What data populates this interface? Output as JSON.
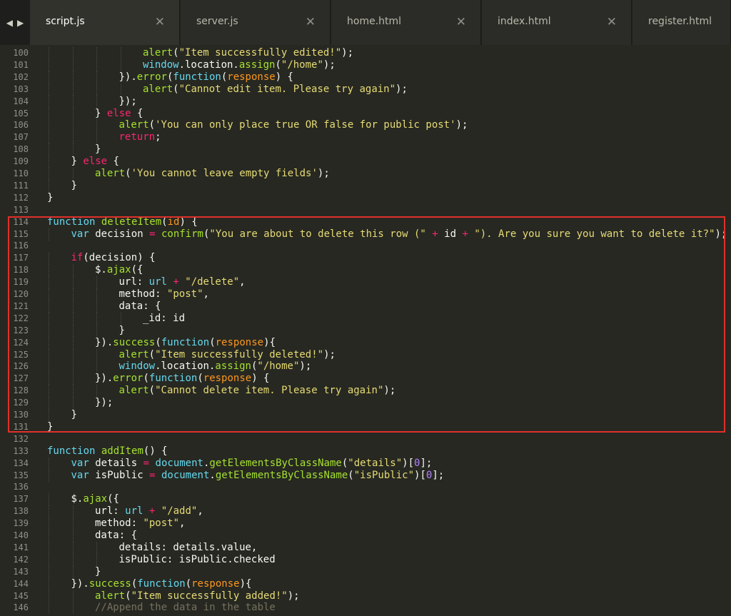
{
  "tabs": [
    {
      "label": "script.js",
      "active": true
    },
    {
      "label": "server.js",
      "active": false
    },
    {
      "label": "home.html",
      "active": false
    },
    {
      "label": "index.html",
      "active": false
    },
    {
      "label": "register.html",
      "active": false
    }
  ],
  "nav": {
    "back": "◀",
    "forward": "▶"
  },
  "tab_close_glyph": "✕",
  "highlight": {
    "color": "#e0302a",
    "from_line": 114,
    "to_line": 131
  },
  "lines": [
    {
      "n": "100",
      "indent": 4,
      "tokens": [
        [
          "fn",
          "alert"
        ],
        [
          "pl",
          "("
        ],
        [
          "str",
          "\"Item successfully edited!\""
        ],
        [
          "pl",
          ");"
        ]
      ]
    },
    {
      "n": "101",
      "indent": 4,
      "tokens": [
        [
          "bi",
          "window"
        ],
        [
          "pl",
          ".location."
        ],
        [
          "fn",
          "assign"
        ],
        [
          "pl",
          "("
        ],
        [
          "str",
          "\"/home\""
        ],
        [
          "pl",
          ");"
        ]
      ]
    },
    {
      "n": "102",
      "indent": 3,
      "tokens": [
        [
          "pl",
          "})."
        ],
        [
          "fn",
          "error"
        ],
        [
          "pl",
          "("
        ],
        [
          "bi",
          "function"
        ],
        [
          "pl",
          "("
        ],
        [
          "prm",
          "response"
        ],
        [
          "pl",
          ") {"
        ]
      ]
    },
    {
      "n": "103",
      "indent": 4,
      "tokens": [
        [
          "fn",
          "alert"
        ],
        [
          "pl",
          "("
        ],
        [
          "str",
          "\"Cannot edit item. Please try again\""
        ],
        [
          "pl",
          ");"
        ]
      ]
    },
    {
      "n": "104",
      "indent": 3,
      "tokens": [
        [
          "pl",
          "});"
        ]
      ]
    },
    {
      "n": "105",
      "indent": 2,
      "tokens": [
        [
          "pl",
          "} "
        ],
        [
          "kw",
          "else"
        ],
        [
          "pl",
          " {"
        ]
      ]
    },
    {
      "n": "106",
      "indent": 3,
      "tokens": [
        [
          "fn",
          "alert"
        ],
        [
          "pl",
          "("
        ],
        [
          "str",
          "'You can only place true OR false for public post'"
        ],
        [
          "pl",
          ");"
        ]
      ]
    },
    {
      "n": "107",
      "indent": 3,
      "tokens": [
        [
          "kw",
          "return"
        ],
        [
          "pl",
          ";"
        ]
      ]
    },
    {
      "n": "108",
      "indent": 2,
      "tokens": [
        [
          "pl",
          "}"
        ]
      ]
    },
    {
      "n": "109",
      "indent": 1,
      "tokens": [
        [
          "pl",
          "} "
        ],
        [
          "kw",
          "else"
        ],
        [
          "pl",
          " {"
        ]
      ]
    },
    {
      "n": "110",
      "indent": 2,
      "tokens": [
        [
          "fn",
          "alert"
        ],
        [
          "pl",
          "("
        ],
        [
          "str",
          "'You cannot leave empty fields'"
        ],
        [
          "pl",
          ");"
        ]
      ]
    },
    {
      "n": "111",
      "indent": 1,
      "tokens": [
        [
          "pl",
          "}"
        ]
      ]
    },
    {
      "n": "112",
      "indent": 0,
      "tokens": [
        [
          "pl",
          "}"
        ]
      ]
    },
    {
      "n": "113",
      "indent": 0,
      "tokens": []
    },
    {
      "n": "114",
      "indent": 0,
      "tokens": [
        [
          "bi",
          "function"
        ],
        [
          "pl",
          " "
        ],
        [
          "fn",
          "deleteItem"
        ],
        [
          "pl",
          "("
        ],
        [
          "prm",
          "id"
        ],
        [
          "pl",
          ") {"
        ]
      ]
    },
    {
      "n": "115",
      "indent": 1,
      "tokens": [
        [
          "bi",
          "var"
        ],
        [
          "pl",
          " decision "
        ],
        [
          "kw",
          "="
        ],
        [
          "pl",
          " "
        ],
        [
          "fn",
          "confirm"
        ],
        [
          "pl",
          "("
        ],
        [
          "str",
          "\"You are about to delete this row (\""
        ],
        [
          "pl",
          " "
        ],
        [
          "kw",
          "+"
        ],
        [
          "pl",
          " id "
        ],
        [
          "kw",
          "+"
        ],
        [
          "pl",
          " "
        ],
        [
          "str",
          "\"). Are you sure you want to delete it?\""
        ],
        [
          "pl",
          ");"
        ]
      ]
    },
    {
      "n": "116",
      "indent": 0,
      "tokens": []
    },
    {
      "n": "117",
      "indent": 1,
      "tokens": [
        [
          "kw",
          "if"
        ],
        [
          "pl",
          "(decision) {"
        ]
      ]
    },
    {
      "n": "118",
      "indent": 2,
      "tokens": [
        [
          "pl",
          "$."
        ],
        [
          "fn",
          "ajax"
        ],
        [
          "pl",
          "({"
        ]
      ]
    },
    {
      "n": "119",
      "indent": 3,
      "tokens": [
        [
          "pl",
          "url: "
        ],
        [
          "bi",
          "url"
        ],
        [
          "pl",
          " "
        ],
        [
          "kw",
          "+"
        ],
        [
          "pl",
          " "
        ],
        [
          "str",
          "\"/delete\""
        ],
        [
          "pl",
          ","
        ]
      ]
    },
    {
      "n": "120",
      "indent": 3,
      "tokens": [
        [
          "pl",
          "method: "
        ],
        [
          "str",
          "\"post\""
        ],
        [
          "pl",
          ","
        ]
      ]
    },
    {
      "n": "121",
      "indent": 3,
      "tokens": [
        [
          "pl",
          "data: {"
        ]
      ]
    },
    {
      "n": "122",
      "indent": 4,
      "tokens": [
        [
          "pl",
          "_id: id"
        ]
      ]
    },
    {
      "n": "123",
      "indent": 3,
      "tokens": [
        [
          "pl",
          "}"
        ]
      ]
    },
    {
      "n": "124",
      "indent": 2,
      "tokens": [
        [
          "pl",
          "})."
        ],
        [
          "fn",
          "success"
        ],
        [
          "pl",
          "("
        ],
        [
          "bi",
          "function"
        ],
        [
          "pl",
          "("
        ],
        [
          "prm",
          "response"
        ],
        [
          "pl",
          "){"
        ]
      ]
    },
    {
      "n": "125",
      "indent": 3,
      "tokens": [
        [
          "fn",
          "alert"
        ],
        [
          "pl",
          "("
        ],
        [
          "str",
          "\"Item successfully deleted!\""
        ],
        [
          "pl",
          ");"
        ]
      ]
    },
    {
      "n": "126",
      "indent": 3,
      "tokens": [
        [
          "bi",
          "window"
        ],
        [
          "pl",
          ".location."
        ],
        [
          "fn",
          "assign"
        ],
        [
          "pl",
          "("
        ],
        [
          "str",
          "\"/home\""
        ],
        [
          "pl",
          ");"
        ]
      ]
    },
    {
      "n": "127",
      "indent": 2,
      "tokens": [
        [
          "pl",
          "})."
        ],
        [
          "fn",
          "error"
        ],
        [
          "pl",
          "("
        ],
        [
          "bi",
          "function"
        ],
        [
          "pl",
          "("
        ],
        [
          "prm",
          "response"
        ],
        [
          "pl",
          ") {"
        ]
      ]
    },
    {
      "n": "128",
      "indent": 3,
      "tokens": [
        [
          "fn",
          "alert"
        ],
        [
          "pl",
          "("
        ],
        [
          "str",
          "\"Cannot delete item. Please try again\""
        ],
        [
          "pl",
          ");"
        ]
      ]
    },
    {
      "n": "129",
      "indent": 2,
      "tokens": [
        [
          "pl",
          "});"
        ]
      ]
    },
    {
      "n": "130",
      "indent": 1,
      "tokens": [
        [
          "pl",
          "}"
        ]
      ]
    },
    {
      "n": "131",
      "indent": 0,
      "tokens": [
        [
          "pl",
          "}"
        ]
      ]
    },
    {
      "n": "132",
      "indent": 0,
      "tokens": []
    },
    {
      "n": "133",
      "indent": 0,
      "tokens": [
        [
          "bi",
          "function"
        ],
        [
          "pl",
          " "
        ],
        [
          "fn",
          "addItem"
        ],
        [
          "pl",
          "() {"
        ]
      ]
    },
    {
      "n": "134",
      "indent": 1,
      "tokens": [
        [
          "bi",
          "var"
        ],
        [
          "pl",
          " details "
        ],
        [
          "kw",
          "="
        ],
        [
          "pl",
          " "
        ],
        [
          "bi",
          "document"
        ],
        [
          "pl",
          "."
        ],
        [
          "fn",
          "getElementsByClassName"
        ],
        [
          "pl",
          "("
        ],
        [
          "str",
          "\"details\""
        ],
        [
          "pl",
          ")["
        ],
        [
          "num",
          "0"
        ],
        [
          "pl",
          "];"
        ]
      ]
    },
    {
      "n": "135",
      "indent": 1,
      "tokens": [
        [
          "bi",
          "var"
        ],
        [
          "pl",
          " isPublic "
        ],
        [
          "kw",
          "="
        ],
        [
          "pl",
          " "
        ],
        [
          "bi",
          "document"
        ],
        [
          "pl",
          "."
        ],
        [
          "fn",
          "getElementsByClassName"
        ],
        [
          "pl",
          "("
        ],
        [
          "str",
          "\"isPublic\""
        ],
        [
          "pl",
          ")["
        ],
        [
          "num",
          "0"
        ],
        [
          "pl",
          "];"
        ]
      ]
    },
    {
      "n": "136",
      "indent": 0,
      "tokens": []
    },
    {
      "n": "137",
      "indent": 1,
      "tokens": [
        [
          "pl",
          "$."
        ],
        [
          "fn",
          "ajax"
        ],
        [
          "pl",
          "({"
        ]
      ]
    },
    {
      "n": "138",
      "indent": 2,
      "tokens": [
        [
          "pl",
          "url: "
        ],
        [
          "bi",
          "url"
        ],
        [
          "pl",
          " "
        ],
        [
          "kw",
          "+"
        ],
        [
          "pl",
          " "
        ],
        [
          "str",
          "\"/add\""
        ],
        [
          "pl",
          ","
        ]
      ]
    },
    {
      "n": "139",
      "indent": 2,
      "tokens": [
        [
          "pl",
          "method: "
        ],
        [
          "str",
          "\"post\""
        ],
        [
          "pl",
          ","
        ]
      ]
    },
    {
      "n": "140",
      "indent": 2,
      "tokens": [
        [
          "pl",
          "data: {"
        ]
      ]
    },
    {
      "n": "141",
      "indent": 3,
      "tokens": [
        [
          "pl",
          "details: details.value,"
        ]
      ]
    },
    {
      "n": "142",
      "indent": 3,
      "tokens": [
        [
          "pl",
          "isPublic: isPublic.checked"
        ]
      ]
    },
    {
      "n": "143",
      "indent": 2,
      "tokens": [
        [
          "pl",
          "}"
        ]
      ]
    },
    {
      "n": "144",
      "indent": 1,
      "tokens": [
        [
          "pl",
          "})."
        ],
        [
          "fn",
          "success"
        ],
        [
          "pl",
          "("
        ],
        [
          "bi",
          "function"
        ],
        [
          "pl",
          "("
        ],
        [
          "prm",
          "response"
        ],
        [
          "pl",
          "){"
        ]
      ]
    },
    {
      "n": "145",
      "indent": 2,
      "tokens": [
        [
          "fn",
          "alert"
        ],
        [
          "pl",
          "("
        ],
        [
          "str",
          "\"Item successfully added!\""
        ],
        [
          "pl",
          ");"
        ]
      ]
    },
    {
      "n": "146",
      "indent": 2,
      "tokens": [
        [
          "cm",
          "//Append the data in the table"
        ]
      ]
    }
  ]
}
